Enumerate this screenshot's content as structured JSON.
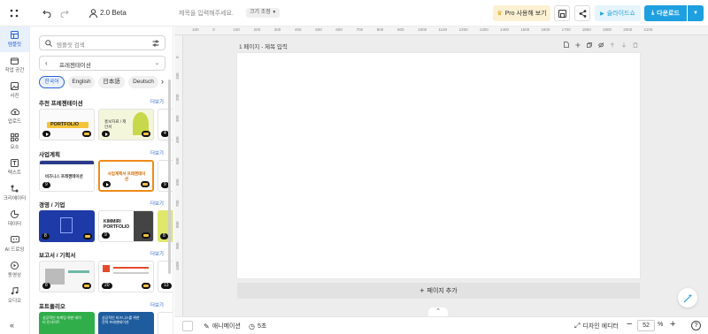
{
  "header": {
    "version": "2.0 Beta",
    "title_placeholder": "제목을 입력해주세요.",
    "size_button": "크기 조정",
    "pro_button": "Pro 사용해 보기",
    "slideshow_button": "슬라이드쇼",
    "download_button": "다운로드"
  },
  "rail": [
    {
      "label": "템플릿",
      "icon": "template-icon"
    },
    {
      "label": "작업 공간",
      "icon": "workspace-icon"
    },
    {
      "label": "사진",
      "icon": "photo-icon"
    },
    {
      "label": "업로드",
      "icon": "upload-icon"
    },
    {
      "label": "요소",
      "icon": "elements-icon"
    },
    {
      "label": "텍스트",
      "icon": "text-icon"
    },
    {
      "label": "크리에이터",
      "icon": "creator-icon"
    },
    {
      "label": "데이터",
      "icon": "data-icon"
    },
    {
      "label": "AI 드로잉",
      "icon": "ai-drawing-icon"
    },
    {
      "label": "동영상",
      "icon": "video-icon"
    },
    {
      "label": "오디오",
      "icon": "audio-icon"
    }
  ],
  "panel": {
    "search_placeholder": "템플릿 검색",
    "category": "프레젠테이션",
    "languages": [
      "한국어",
      "English",
      "日本語",
      "Deutsch"
    ],
    "more_label": "더보기",
    "sections": [
      {
        "title": "추천 프레젠테이션",
        "badges": [
          "",
          "",
          "4"
        ]
      },
      {
        "title": "사업계획",
        "badges": [
          "9",
          "",
          "9"
        ]
      },
      {
        "title": "경영 / 기업",
        "badges": [
          "8",
          "9",
          "8"
        ]
      },
      {
        "title": "보고서 / 기획서",
        "badges": [
          "8",
          "20",
          "13"
        ]
      },
      {
        "title": "포트폴리오",
        "badges": []
      }
    ],
    "thumb_texts": {
      "portfolio": "PORTFOLIO",
      "kr_proposal": "홍보자료 / 제안서",
      "biz_plan": "비즈니스 프레젠테이션",
      "biz_plan2": "사업계획서 프레젠테이션",
      "kimmiri": "KIMMIRI PORTFOLIO",
      "green1": "성공적인 마케팅 위한 데이터 인사이트",
      "blue2": "성공적인 비즈니스를 위한 전략 프레젠테이션"
    }
  },
  "canvas": {
    "page_label": "1 페이지 - 제목 입력",
    "add_page": "페이지 추가",
    "ruler_top": [
      "100",
      "0",
      "100",
      "200",
      "300",
      "400",
      "500",
      "600",
      "700",
      "800",
      "900",
      "1000",
      "1100",
      "1200",
      "1300",
      "1400",
      "1500",
      "1600",
      "1700",
      "1800",
      "1900",
      "2000",
      "2100"
    ],
    "ruler_left": [
      "0",
      "100",
      "200",
      "300",
      "400",
      "500",
      "600",
      "700",
      "800",
      "900",
      "1000"
    ]
  },
  "bottombar": {
    "animation": "애니메이션",
    "duration": "5초",
    "design_editor": "디자인 에디터",
    "zoom": "52",
    "zoom_unit": "%"
  },
  "colors": {
    "accent": "#2a63d6",
    "download": "#1e9fe0",
    "pro_bg": "#fdf1d3"
  }
}
